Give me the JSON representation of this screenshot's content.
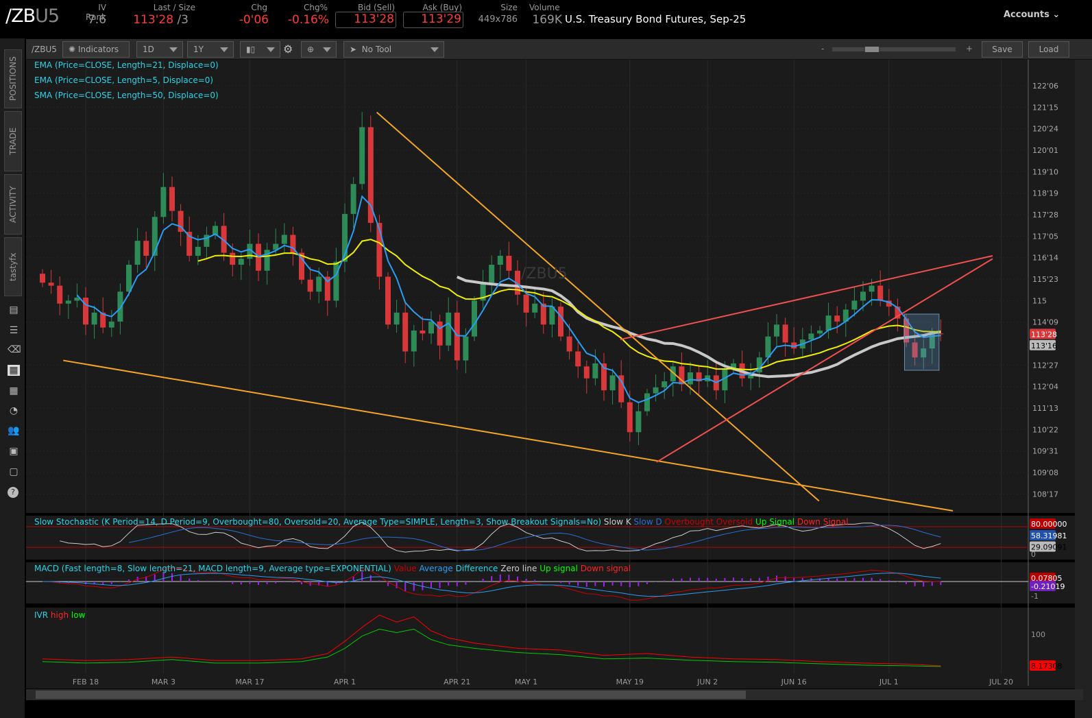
{
  "header": {
    "symbol_main": "/ZB",
    "symbol_suffix": "U5",
    "iv_rank_label": "IV Rank",
    "iv_rank": "7.6",
    "last_label": "Last / Size",
    "last": "113'28",
    "last_size": "/3",
    "chg_label": "Chg",
    "chg": "-0'06",
    "chgp_label": "Chg%",
    "chgp": "-0.16%",
    "bid_label": "Bid (Sell)",
    "bid": "113'28",
    "ask_label": "Ask (Buy)",
    "ask": "113'29",
    "size_label": "Size",
    "size": "449x786",
    "volume_label": "Volume",
    "volume": "169K",
    "description": "U.S. Treasury Bond Futures, Sep-25",
    "accounts": "Accounts"
  },
  "toolbar": {
    "symbol": "/ZBU5",
    "indicators": "Indicators",
    "aggregation": "1D",
    "range": "1Y",
    "tool": "No Tool",
    "zoom_minus": "-",
    "zoom_plus": "+",
    "save": "Save",
    "load": "Load"
  },
  "sidebar": {
    "tabs": [
      "POSITIONS",
      "TRADE",
      "ACTIVITY",
      "tastyfx"
    ]
  },
  "studies": {
    "ema21": "EMA (Price=CLOSE, Length=21, Displace=0)",
    "ema5": "EMA (Price=CLOSE, Length=5, Displace=0)",
    "sma50": "SMA (Price=CLOSE, Length=50, Displace=0)",
    "stoch": "Slow Stochastic (K Period=14, D Period=9, Overbought=80, Oversold=20, Average Type=SIMPLE, Length=3, Show Breakout Signals=No)",
    "stoch_k": "Slow K",
    "stoch_d": "Slow D",
    "stoch_ob": "Overbought",
    "stoch_os": "Oversold",
    "stoch_up": "Up Signal",
    "stoch_down": "Down Signal",
    "macd": "MACD (Fast length=8, Slow length=21, MACD length=9, Average type=EXPONENTIAL)",
    "macd_value": "Value",
    "macd_avg": "Average",
    "macd_diff": "Difference",
    "macd_zero": "Zero line",
    "macd_up": "Up signal",
    "macd_down": "Down signal",
    "ivr": "IVR",
    "ivr_high": "high",
    "ivr_low": "low"
  },
  "watermark": "/ZBU5",
  "colors": {
    "up": "#2e8b57",
    "down": "#d9383a",
    "ema21": "#f0f000",
    "ema5": "#2a9df4",
    "sma50": "#c8c8c8",
    "trend_orange": "#f5a623",
    "trend_red": "#f05050"
  },
  "chart_data": {
    "type": "candlestick",
    "price_axis_labels": [
      "122'06",
      "121'15",
      "120'24",
      "120'01",
      "119'10",
      "118'19",
      "117'28",
      "117'05",
      "116'14",
      "115'23",
      "115",
      "114'09",
      "112'27",
      "112'04",
      "111'13",
      "110'22",
      "109'31",
      "109'08",
      "108'17"
    ],
    "price_axis_values": [
      122.1875,
      121.46875,
      120.75,
      120.03125,
      119.3125,
      118.59375,
      117.875,
      117.15625,
      116.4375,
      115.71875,
      115,
      114.28125,
      112.84375,
      112.125,
      111.40625,
      110.6875,
      109.96875,
      109.25,
      108.53125
    ],
    "last_tag": "113'28",
    "last_tag_value": 113.875,
    "sma_tag": "113'16",
    "sma_tag_value": 113.5,
    "date_labels": [
      {
        "label": "FEB 18",
        "bar": 5
      },
      {
        "label": "MAR 3",
        "bar": 14
      },
      {
        "label": "MAR 17",
        "bar": 24
      },
      {
        "label": "APR 1",
        "bar": 35
      },
      {
        "label": "APR 21",
        "bar": 48
      },
      {
        "label": "MAY 1",
        "bar": 56
      },
      {
        "label": "MAY 19",
        "bar": 68
      },
      {
        "label": "JUN 2",
        "bar": 77
      },
      {
        "label": "JUN 16",
        "bar": 87
      },
      {
        "label": "JUL 1",
        "bar": 98
      },
      {
        "label": "JUL 20",
        "bar": 111
      }
    ],
    "closes": [
      115.6,
      115.5,
      114.9,
      115.0,
      115.1,
      114.2,
      114.6,
      114.1,
      114.3,
      115.3,
      116.2,
      117.0,
      116.5,
      117.8,
      118.8,
      118.0,
      117.3,
      116.5,
      116.8,
      117.2,
      117.5,
      116.6,
      116.2,
      116.4,
      116.9,
      116.0,
      116.7,
      116.9,
      117.2,
      116.6,
      115.7,
      115.3,
      115.8,
      115.0,
      116.3,
      117.9,
      118.9,
      120.8,
      117.6,
      115.8,
      114.2,
      114.6,
      113.3,
      114.0,
      113.9,
      114.3,
      113.5,
      114.6,
      113.0,
      113.8,
      115.0,
      115.6,
      116.2,
      116.5,
      116.0,
      115.2,
      114.6,
      114.9,
      114.2,
      114.8,
      113.8,
      113.3,
      112.8,
      112.4,
      112.9,
      112.0,
      112.5,
      111.6,
      110.6,
      111.3,
      111.9,
      112.1,
      112.3,
      112.8,
      112.2,
      112.6,
      112.3,
      112.5,
      112.0,
      112.7,
      112.9,
      112.4,
      112.6,
      113.1,
      113.8,
      114.2,
      113.6,
      113.4,
      113.7,
      113.9,
      114.0,
      114.5,
      114.3,
      114.7,
      115.0,
      115.3,
      115.5,
      115.0,
      114.8,
      114.4,
      113.6,
      113.1,
      113.4,
      113.9,
      113.875
    ],
    "first_open": 115.9,
    "trendlines": [
      {
        "color": "orange",
        "from": [
          38.7,
          121.3
        ],
        "to": [
          89.9,
          108.3
        ]
      },
      {
        "color": "orange",
        "from": [
          2.4,
          113.0
        ],
        "to": [
          105.4,
          107.97
        ]
      },
      {
        "color": "red",
        "from": [
          66.9,
          113.7
        ],
        "to": [
          110,
          116.5
        ]
      },
      {
        "color": "red",
        "from": [
          71.1,
          109.6
        ],
        "to": [
          110,
          116.4
        ]
      }
    ],
    "box": {
      "from": [
        99.8,
        114.55
      ],
      "to": [
        103.8,
        112.67
      ]
    },
    "stoch_tags": [
      "80.00000",
      "58.31981",
      "29.09091"
    ],
    "stoch_axis": "0",
    "macd_tags": [
      "0.07805",
      "-0.21019"
    ],
    "macd_axis": "-1",
    "ivr_data": {
      "x": [
        0,
        5,
        10,
        15,
        20,
        25,
        30,
        33,
        35,
        37,
        39,
        41,
        43,
        45,
        47,
        50,
        55,
        60,
        65,
        70,
        75,
        80,
        85,
        90,
        95,
        100,
        104
      ],
      "high": [
        30,
        25,
        28,
        35,
        25,
        25,
        30,
        45,
        80,
        120,
        155,
        135,
        150,
        110,
        90,
        75,
        60,
        55,
        40,
        45,
        35,
        30,
        28,
        22,
        18,
        15,
        10
      ],
      "low": [
        22,
        18,
        20,
        28,
        18,
        18,
        22,
        35,
        60,
        95,
        115,
        105,
        115,
        85,
        70,
        60,
        48,
        42,
        30,
        32,
        26,
        22,
        20,
        16,
        12,
        10,
        8
      ]
    },
    "ivr_tag": "8.17308",
    "ivr_axis": "100"
  }
}
